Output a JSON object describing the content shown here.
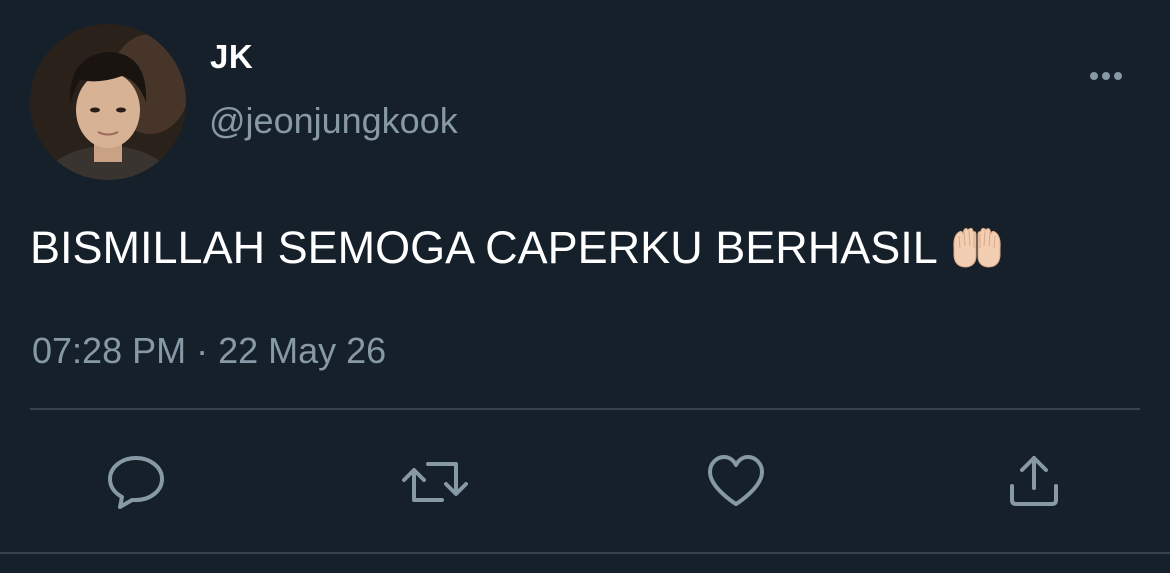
{
  "user": {
    "display_name": "JK",
    "handle": "@jeonjungkook"
  },
  "tweet": {
    "text": "BISMILLAH SEMOGA CAPERKU BERHASIL",
    "emoji": "raised-palms-together",
    "timestamp": "07:28 PM · 22 May 26"
  },
  "icons": {
    "more": "more-horizontal-icon",
    "reply": "reply-icon",
    "retweet": "retweet-icon",
    "like": "heart-icon",
    "share": "share-icon"
  },
  "colors": {
    "background": "#15202b",
    "text": "#ffffff",
    "secondary_text": "#8899a6",
    "divider": "#38444d"
  }
}
